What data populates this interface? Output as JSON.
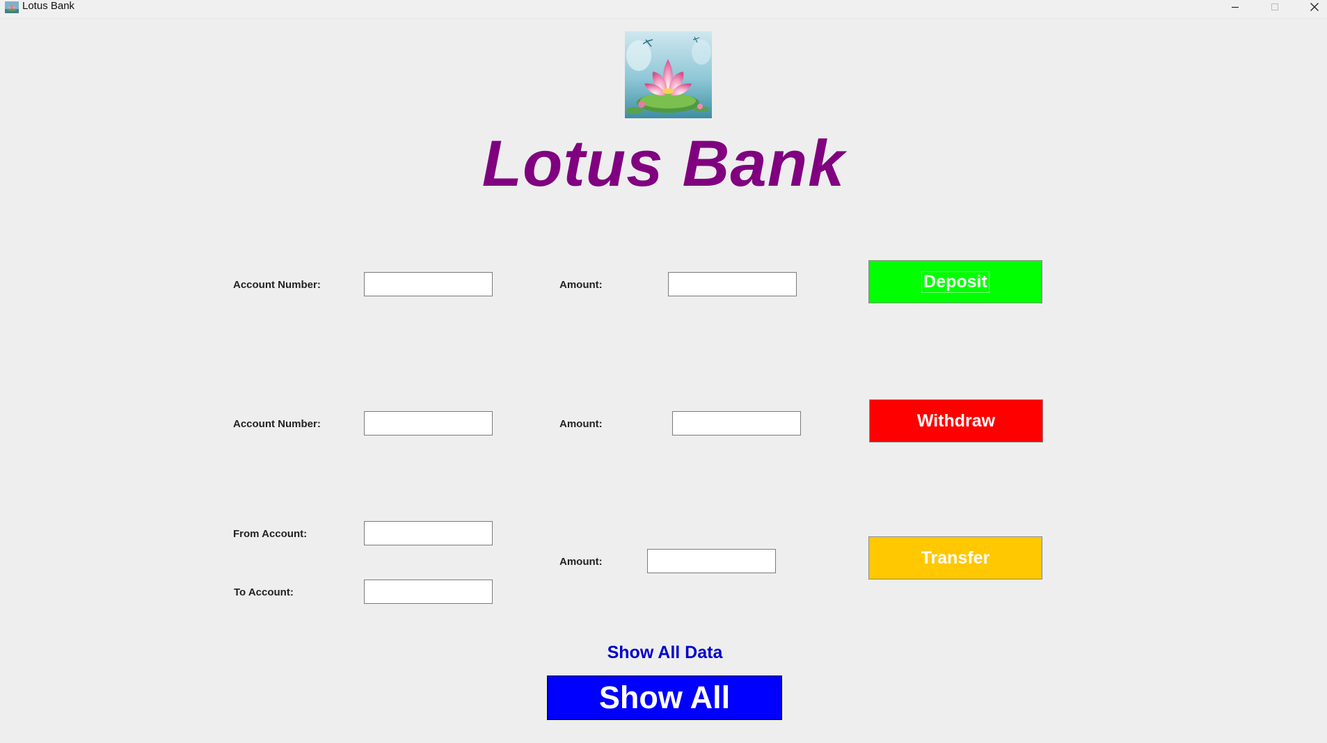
{
  "window": {
    "title": "Lotus Bank",
    "icon": "lotus-app-icon",
    "controls": [
      "minimize-icon",
      "maximize-icon",
      "close-icon"
    ]
  },
  "header": {
    "logo": "lotus-flower-logo",
    "title": "Lotus Bank",
    "title_color": "#800080"
  },
  "deposit": {
    "account_label": "Account Number:",
    "account_value": "",
    "amount_label": "Amount:",
    "amount_value": "",
    "button_label": "Deposit",
    "button_color": "#00ff00"
  },
  "withdraw": {
    "account_label": "Account Number:",
    "account_value": "",
    "amount_label": "Amount:",
    "amount_value": "",
    "button_label": "Withdraw",
    "button_color": "#ff0000"
  },
  "transfer": {
    "from_label": "From Account:",
    "from_value": "",
    "to_label": "To Account:",
    "to_value": "",
    "amount_label": "Amount:",
    "amount_value": "",
    "button_label": "Transfer",
    "button_color": "#ffc800"
  },
  "show_all": {
    "heading": "Show All Data",
    "button_label": "Show All",
    "button_color": "#0000ff"
  }
}
